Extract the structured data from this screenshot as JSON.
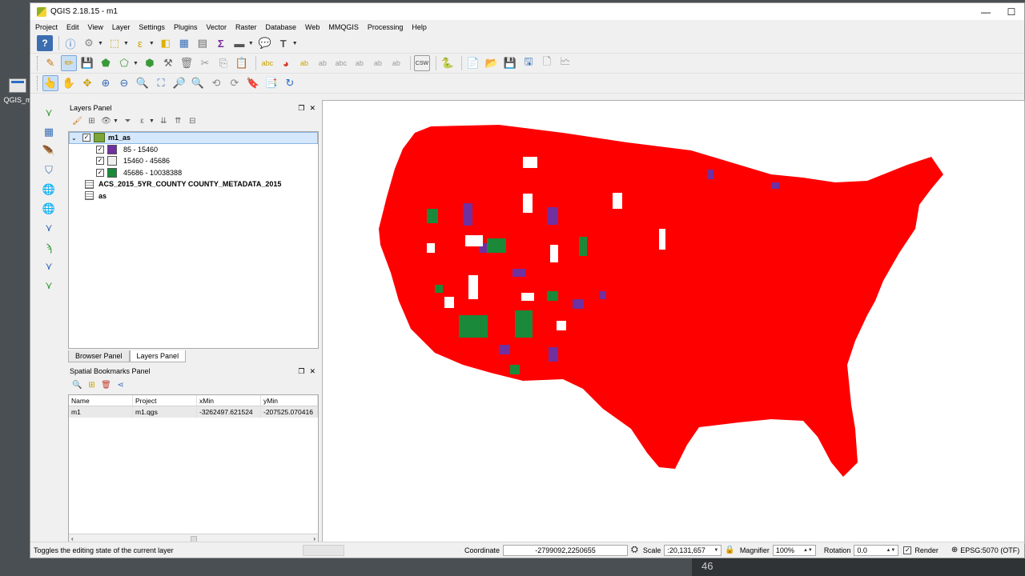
{
  "desktop": {
    "icon_label": "QGIS_m",
    "taskbar_number": "46"
  },
  "window": {
    "title": "QGIS 2.18.15 - m1",
    "minimize": "—",
    "maximize": "☐"
  },
  "menu": [
    "Project",
    "Edit",
    "View",
    "Layer",
    "Settings",
    "Plugins",
    "Vector",
    "Raster",
    "Database",
    "Web",
    "MMQGIS",
    "Processing",
    "Help"
  ],
  "toolbar": {
    "csw_label": "CSW"
  },
  "layers_panel": {
    "title": "Layers Panel",
    "layers": [
      {
        "name": "m1_as"
      },
      {
        "name": "85 - 15460"
      },
      {
        "name": "15460 - 45686"
      },
      {
        "name": "45686 - 10038388"
      },
      {
        "name": "ACS_2015_5YR_COUNTY COUNTY_METADATA_2015"
      },
      {
        "name": "as"
      }
    ],
    "legend_colors": [
      "#7030a0",
      "#f0f0f0",
      "#1a8a3a"
    ],
    "tabs": [
      "Browser Panel",
      "Layers Panel"
    ]
  },
  "bookmarks_panel": {
    "title": "Spatial Bookmarks Panel",
    "columns": [
      "Name",
      "Project",
      "xMin",
      "yMin"
    ],
    "rows": [
      {
        "name": "m1",
        "project": "m1.qgs",
        "xmin": "-3262497.621524",
        "ymin": "-207525.070416"
      }
    ]
  },
  "map": {
    "fill_color": "#ff0000"
  },
  "statusbar": {
    "message": "Toggles the editing state of the current layer",
    "coordinate_label": "Coordinate",
    "coordinate_value": "-2799092,2250655",
    "scale_label": "Scale",
    "scale_value": ":20,131,657",
    "magnifier_label": "Magnifier",
    "magnifier_value": "100%",
    "rotation_label": "Rotation",
    "rotation_value": "0.0",
    "render_label": "Render",
    "crs_label": "EPSG:5070 (OTF)"
  }
}
